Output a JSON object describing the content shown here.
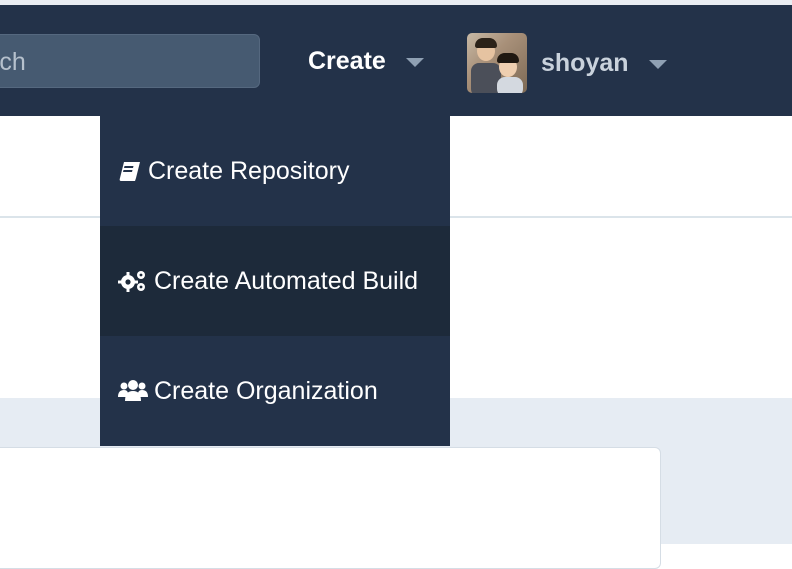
{
  "navbar": {
    "search_text": "rch",
    "create_label": "Create",
    "username": "shoyan"
  },
  "dropdown": {
    "items": [
      {
        "label": "Create Repository",
        "icon": "book-icon"
      },
      {
        "label": "Create Automated Build",
        "icon": "gears-icon"
      },
      {
        "label": "Create Organization",
        "icon": "users-icon"
      }
    ]
  },
  "colors": {
    "navbar_bg": "#233249",
    "menu_active_bg": "#1d2a3a",
    "page_gray": "#e6ecf3"
  }
}
